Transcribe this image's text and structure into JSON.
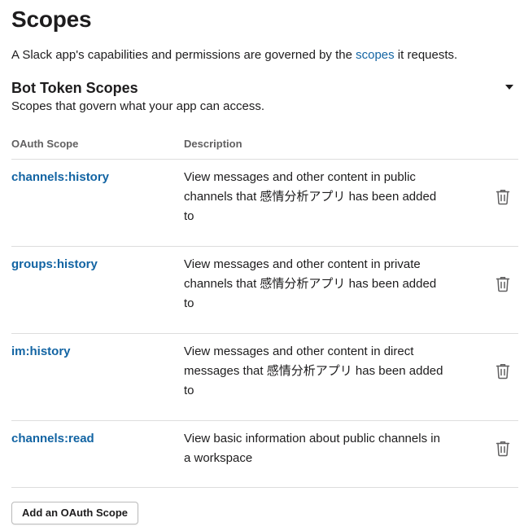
{
  "page": {
    "title": "Scopes",
    "intro_before": "A Slack app's capabilities and permissions are governed by the ",
    "intro_link": "scopes",
    "intro_after": " it requests."
  },
  "section": {
    "title": "Bot Token Scopes",
    "subtitle": "Scopes that govern what your app can access."
  },
  "table": {
    "headers": {
      "scope": "OAuth Scope",
      "description": "Description"
    },
    "rows": [
      {
        "scope": "channels:history",
        "description": "View messages and other content in public channels that 感情分析アプリ has been added to"
      },
      {
        "scope": "groups:history",
        "description": "View messages and other content in private channels that 感情分析アプリ has been added to"
      },
      {
        "scope": "im:history",
        "description": "View messages and other content in direct messages that 感情分析アプリ has been added to"
      },
      {
        "scope": "channels:read",
        "description": "View basic information about public channels in a workspace"
      }
    ]
  },
  "actions": {
    "add_scope_label": "Add an OAuth Scope"
  },
  "icons": {
    "collapse": "caret-down-icon",
    "remove": "trash-icon"
  },
  "colors": {
    "link": "#1264a3",
    "text": "#1d1c1d",
    "muted": "#616061",
    "divider": "#dddddd"
  }
}
